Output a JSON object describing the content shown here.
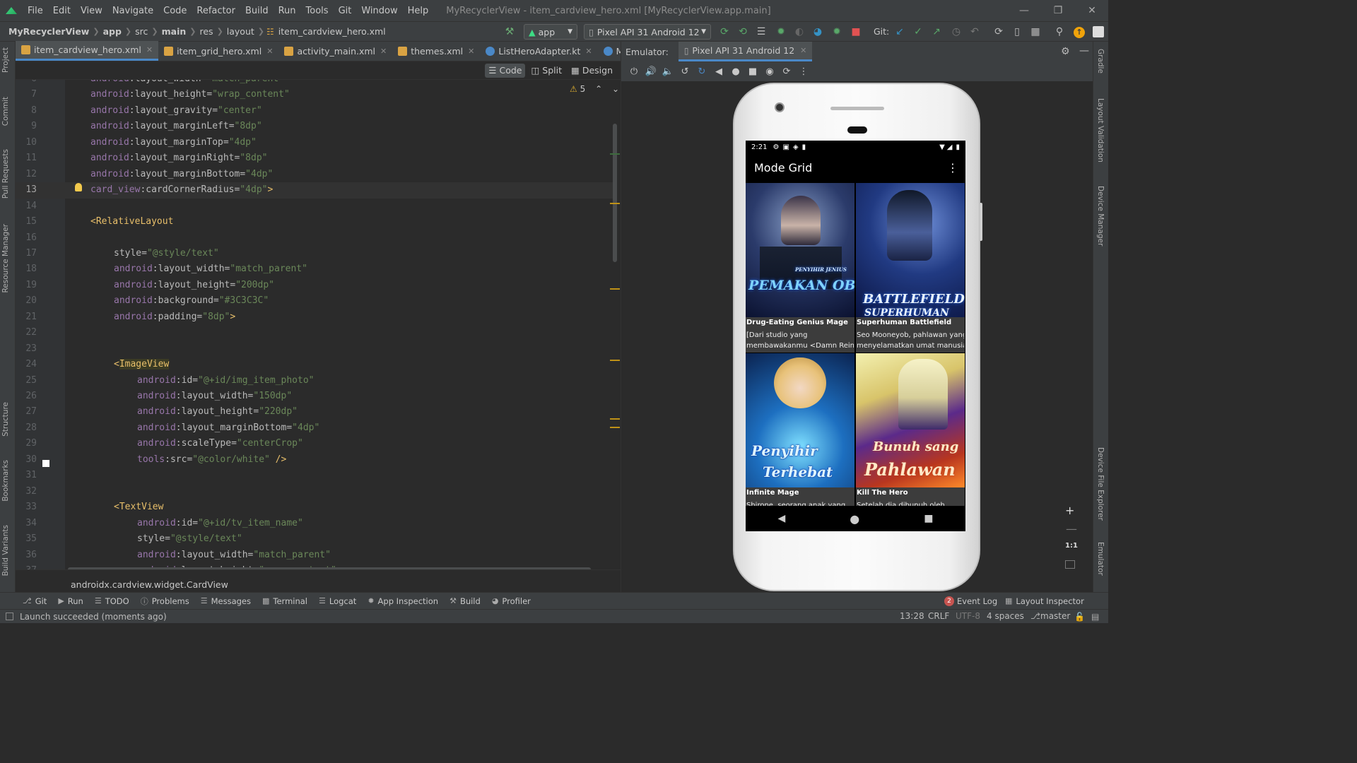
{
  "menu": {
    "items": [
      "File",
      "Edit",
      "View",
      "Navigate",
      "Code",
      "Refactor",
      "Build",
      "Run",
      "Tools",
      "Git",
      "Window",
      "Help"
    ],
    "window_title": "MyRecyclerView - item_cardview_hero.xml [MyRecyclerView.app.main]"
  },
  "breadcrumb": [
    "MyRecyclerView",
    "app",
    "src",
    "main",
    "res",
    "layout",
    "item_cardview_hero.xml"
  ],
  "toolbar": {
    "run_config": "app",
    "device": "Pixel API 31 Android 12",
    "git_label": "Git:"
  },
  "editor_tabs": [
    {
      "label": "item_cardview_hero.xml",
      "active": true
    },
    {
      "label": "item_grid_hero.xml"
    },
    {
      "label": "activity_main.xml"
    },
    {
      "label": "themes.xml"
    },
    {
      "label": "ListHeroAdapter.kt"
    },
    {
      "label": "Mai"
    }
  ],
  "editor_modes": [
    "Code",
    "Split",
    "Design"
  ],
  "warnings_count": "5",
  "code": {
    "lines": [
      {
        "n": "6",
        "t": "android:layout_width=\"match_parent\""
      },
      {
        "n": "7",
        "t": "android:layout_height=\"wrap_content\""
      },
      {
        "n": "8",
        "t": "android:layout_gravity=\"center\""
      },
      {
        "n": "9",
        "t": "android:layout_marginLeft=\"8dp\""
      },
      {
        "n": "10",
        "t": "android:layout_marginTop=\"4dp\""
      },
      {
        "n": "11",
        "t": "android:layout_marginRight=\"8dp\""
      },
      {
        "n": "12",
        "t": "android:layout_marginBottom=\"4dp\""
      },
      {
        "n": "13",
        "t": "card_view:cardCornerRadius=\"4dp\">"
      },
      {
        "n": "14",
        "t": ""
      },
      {
        "n": "15",
        "t": "<RelativeLayout"
      },
      {
        "n": "16",
        "t": ""
      },
      {
        "n": "17",
        "t": "style=\"@style/text\""
      },
      {
        "n": "18",
        "t": "android:layout_width=\"match_parent\""
      },
      {
        "n": "19",
        "t": "android:layout_height=\"200dp\""
      },
      {
        "n": "20",
        "t": "android:background=\"#3C3C3C\""
      },
      {
        "n": "21",
        "t": "android:padding=\"8dp\">"
      },
      {
        "n": "22",
        "t": ""
      },
      {
        "n": "23",
        "t": ""
      },
      {
        "n": "24",
        "t": "<ImageView"
      },
      {
        "n": "25",
        "t": "android:id=\"@+id/img_item_photo\""
      },
      {
        "n": "26",
        "t": "android:layout_width=\"150dp\""
      },
      {
        "n": "27",
        "t": "android:layout_height=\"220dp\""
      },
      {
        "n": "28",
        "t": "android:layout_marginBottom=\"4dp\""
      },
      {
        "n": "29",
        "t": "android:scaleType=\"centerCrop\""
      },
      {
        "n": "30",
        "t": "tools:src=\"@color/white\" />"
      },
      {
        "n": "31",
        "t": ""
      },
      {
        "n": "32",
        "t": ""
      },
      {
        "n": "33",
        "t": "<TextView"
      },
      {
        "n": "34",
        "t": "android:id=\"@+id/tv_item_name\""
      },
      {
        "n": "35",
        "t": "style=\"@style/text\""
      },
      {
        "n": "36",
        "t": "android:layout_width=\"match_parent\""
      },
      {
        "n": "37",
        "t": "android:layout_height=\"wrap_content\""
      }
    ]
  },
  "editor_breadcrumb": "androidx.cardview.widget.CardView",
  "emulator": {
    "label": "Emulator:",
    "tab": "Pixel API 31 Android 12",
    "zoom_label": "1:1"
  },
  "phone": {
    "time": "2:21",
    "app_title": "Mode Grid",
    "cards": [
      {
        "name": "Drug-Eating Genius Mage",
        "desc1": "[Dari studio yang",
        "desc2": "membawakanmu <Damn Reinc...",
        "art1": "PENYIHIR JENIUS",
        "art2": "PEMAKAN OBAT"
      },
      {
        "name": "Superhuman Battlefield",
        "desc1": "Seo Mooneyob, pahlawan yang",
        "desc2": "menyelamatkan umat manusia ...",
        "art1": "BATTLEFIELD",
        "art2": "SUPERHUMAN"
      },
      {
        "name": "Infinite Mage",
        "desc1": "Shirone, seorang anak yang",
        "desc2": "",
        "art1": "Penyihir",
        "art2": "Terhebat"
      },
      {
        "name": "Kill The Hero",
        "desc1": "Setelah dia dibunuh oleh",
        "desc2": "",
        "art1": "Bunuh sang",
        "art2": "Pahlawan"
      }
    ]
  },
  "bottom_tools": [
    "Git",
    "Run",
    "TODO",
    "Problems",
    "Messages",
    "Terminal",
    "Logcat",
    "App Inspection",
    "Build",
    "Profiler"
  ],
  "bottom_right_tools": {
    "event_log": "Event Log",
    "event_count": "2",
    "layout_inspector": "Layout Inspector"
  },
  "left_tool_tabs": [
    "Project",
    "Commit",
    "Pull Requests",
    "Resource Manager",
    "Structure",
    "Bookmarks",
    "Build Variants"
  ],
  "right_tool_tabs": [
    "Gradle",
    "Layout Validation",
    "Device Manager",
    "Device File Explorer",
    "Emulator"
  ],
  "status": {
    "message": "Launch succeeded (moments ago)",
    "position": "13:28",
    "line_sep": "CRLF",
    "encoding": "UTF-8",
    "indent": "4 spaces",
    "branch": "master"
  },
  "colors": {
    "accent": "#4a88c7",
    "android_green": "#3ddc84",
    "warning": "#be9117",
    "bg": "#2b2b2b",
    "panel": "#3c3f41"
  }
}
